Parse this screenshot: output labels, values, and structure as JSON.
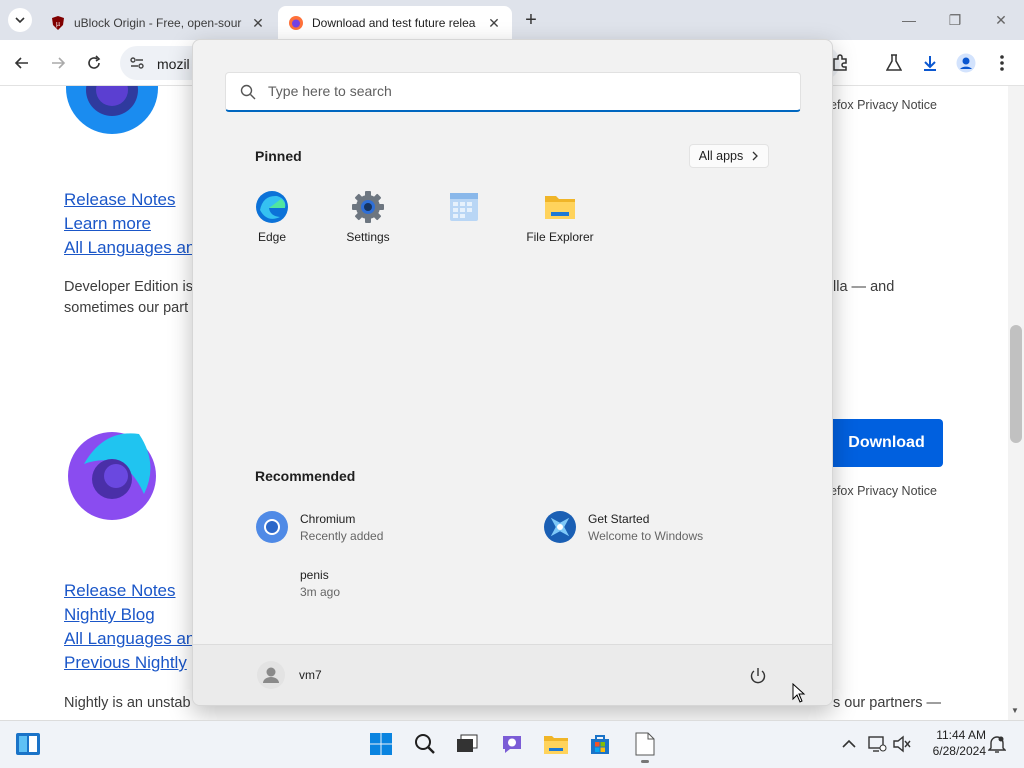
{
  "browser": {
    "tabs": [
      {
        "title": "uBlock Origin - Free, open-sour",
        "state": "inactive"
      },
      {
        "title": "Download and test future relea",
        "state": "active"
      }
    ],
    "new_tab_symbol": "+",
    "address_text": "mozil"
  },
  "page": {
    "section1_links": [
      "Release Notes",
      "Learn more",
      "All Languages an"
    ],
    "section1_text_left_1": "Developer Edition is",
    "section1_text_left_2": "sometimes our part",
    "section1_text_right": "lla — and",
    "privacy_notice": "efox Privacy Notice",
    "download_button": "Download",
    "section2_links": [
      "Release Notes",
      "Nightly Blog",
      "All Languages an",
      "Previous Nightly"
    ],
    "section2_text_left": "Nightly is an unstab",
    "section2_text_right": "s our partners —"
  },
  "start_menu": {
    "search_placeholder": "Type here to search",
    "pinned_heading": "Pinned",
    "all_apps_label": "All apps",
    "pinned": [
      {
        "label": "Edge",
        "icon": "edge-icon"
      },
      {
        "label": "Settings",
        "icon": "settings-gear-icon"
      },
      {
        "label": "",
        "icon": "calendar-icon"
      },
      {
        "label": "File Explorer",
        "icon": "file-explorer-icon"
      }
    ],
    "recommended_heading": "Recommended",
    "recommended": [
      {
        "title": "Chromium",
        "subtitle": "Recently added",
        "icon": "chromium-icon"
      },
      {
        "title": "Get Started",
        "subtitle": "Welcome to Windows",
        "icon": "get-started-icon"
      },
      {
        "title": "penis",
        "subtitle": "3m ago",
        "icon": ""
      }
    ],
    "user_name": "vm7"
  },
  "taskbar": {
    "time": "11:44 AM",
    "date": "6/28/2024"
  },
  "colors": {
    "accent": "#0067c0",
    "link": "#1a56c8",
    "download_button": "#0060df"
  }
}
